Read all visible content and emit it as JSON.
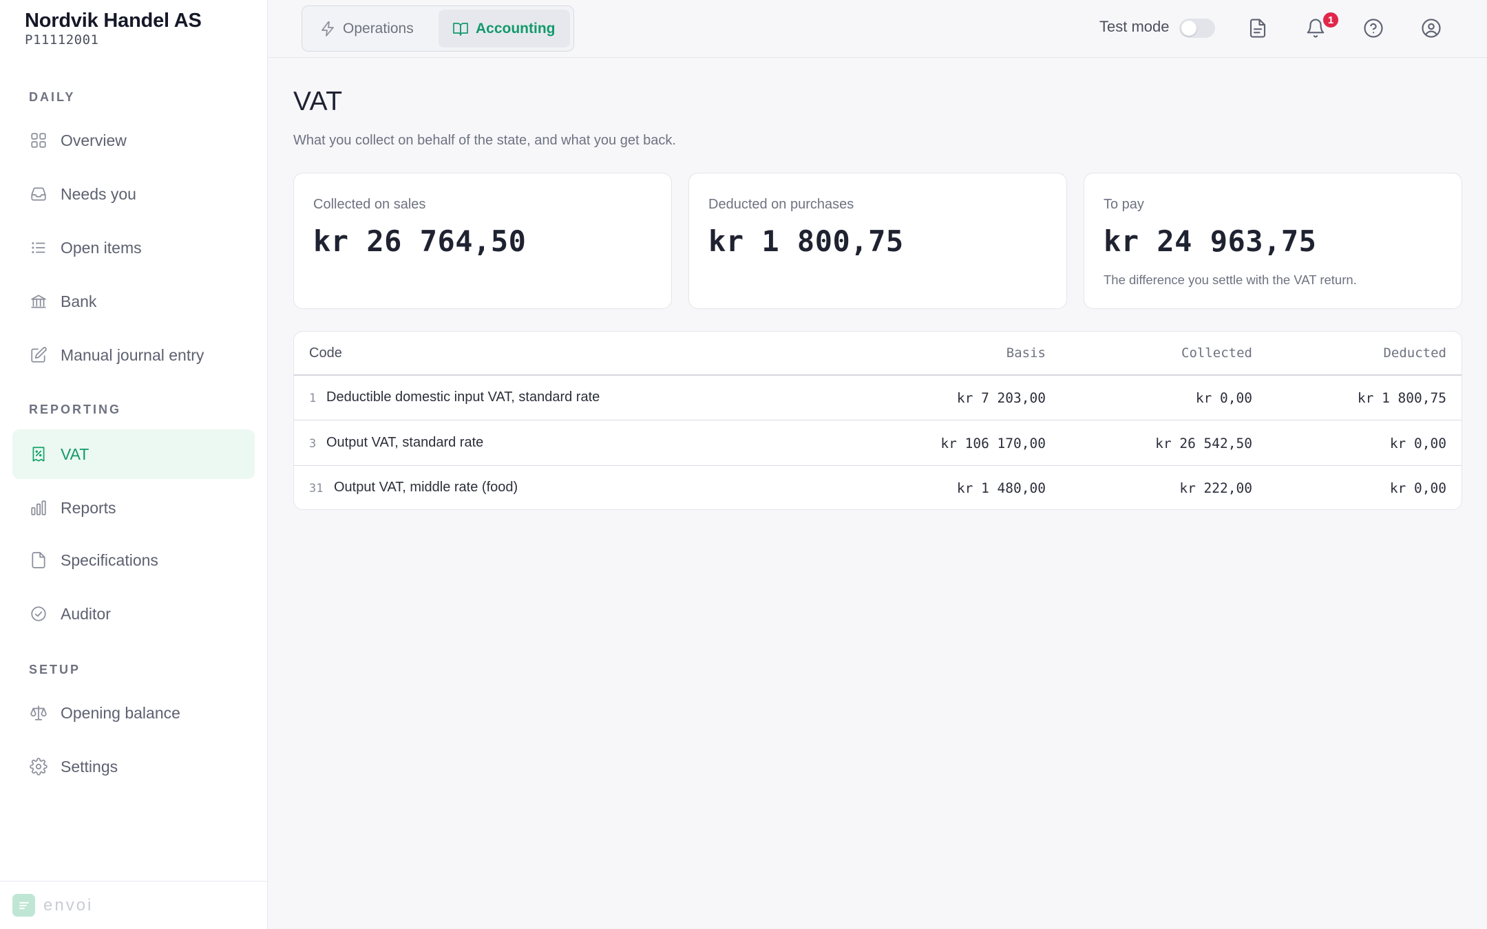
{
  "org": {
    "name": "Nordvik Handel AS",
    "id": "P11112001"
  },
  "sidebar": {
    "sections": [
      {
        "label": "DAILY",
        "items": [
          {
            "label": "Overview",
            "icon": "grid-icon"
          },
          {
            "label": "Needs you",
            "icon": "inbox-icon"
          },
          {
            "label": "Open items",
            "icon": "list-icon"
          },
          {
            "label": "Bank",
            "icon": "bank-icon"
          },
          {
            "label": "Manual journal entry",
            "icon": "pencil-square-icon"
          }
        ]
      },
      {
        "label": "REPORTING",
        "items": [
          {
            "label": "VAT",
            "icon": "receipt-percent-icon",
            "active": true
          },
          {
            "label": "Reports",
            "icon": "bar-chart-icon"
          },
          {
            "label": "Specifications",
            "icon": "file-icon"
          },
          {
            "label": "Auditor",
            "icon": "check-circle-icon"
          }
        ]
      },
      {
        "label": "SETUP",
        "items": [
          {
            "label": "Opening balance",
            "icon": "scale-icon"
          },
          {
            "label": "Settings",
            "icon": "gear-icon"
          }
        ]
      }
    ],
    "footer_brand": "envoi"
  },
  "topbar": {
    "tabs": [
      {
        "label": "Operations",
        "icon": "lightning-icon",
        "active": false
      },
      {
        "label": "Accounting",
        "icon": "book-open-icon",
        "active": true
      }
    ],
    "test_mode_label": "Test mode",
    "test_mode_on": false,
    "notification_count": "1"
  },
  "page": {
    "title": "VAT",
    "subtitle": "What you collect on behalf of the state, and what you get back."
  },
  "cards": [
    {
      "label": "Collected on sales",
      "value": "kr 26 764,50",
      "note": ""
    },
    {
      "label": "Deducted on purchases",
      "value": "kr 1 800,75",
      "note": ""
    },
    {
      "label": "To pay",
      "value": "kr 24 963,75",
      "note": "The difference you settle with the VAT return."
    }
  ],
  "table": {
    "headers": {
      "code": "Code",
      "basis": "Basis",
      "collected": "Collected",
      "deducted": "Deducted"
    },
    "rows": [
      {
        "code": "1",
        "description": "Deductible domestic input VAT, standard rate",
        "basis": "kr 7 203,00",
        "collected": "kr 0,00",
        "deducted": "kr 1 800,75"
      },
      {
        "code": "3",
        "description": "Output VAT, standard rate",
        "basis": "kr 106 170,00",
        "collected": "kr 26 542,50",
        "deducted": "kr 0,00"
      },
      {
        "code": "31",
        "description": "Output VAT, middle rate (food)",
        "basis": "kr 1 480,00",
        "collected": "kr 222,00",
        "deducted": "kr 0,00"
      }
    ]
  },
  "colors": {
    "accent": "#13996a",
    "active_bg": "#ecf8f2",
    "badge": "#e0274a"
  }
}
